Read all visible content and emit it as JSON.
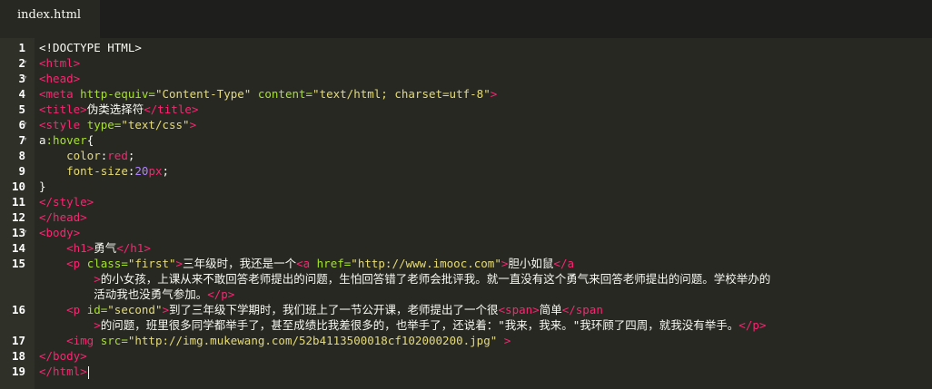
{
  "tab": {
    "filename": "index.html"
  },
  "lines": [
    {
      "n": "1",
      "rows": [
        [
          [
            "p",
            "<!DOCTYPE HTML>"
          ]
        ]
      ]
    },
    {
      "n": "2",
      "fold": true,
      "rows": [
        [
          [
            "t",
            "<html>"
          ]
        ]
      ]
    },
    {
      "n": "3",
      "fold": true,
      "rows": [
        [
          [
            "t",
            "<head>"
          ]
        ]
      ]
    },
    {
      "n": "4",
      "rows": [
        [
          [
            "t",
            "<meta "
          ],
          [
            "a",
            "http-equiv="
          ],
          [
            "s",
            "\"Content-Type\""
          ],
          [
            "a",
            " content="
          ],
          [
            "s",
            "\"text/html; charset=utf-8\""
          ],
          [
            "t",
            ">"
          ]
        ]
      ]
    },
    {
      "n": "5",
      "rows": [
        [
          [
            "t",
            "<title>"
          ],
          [
            "p",
            "伪类选择符"
          ],
          [
            "t",
            "</title>"
          ]
        ]
      ]
    },
    {
      "n": "6",
      "fold": true,
      "rows": [
        [
          [
            "t",
            "<style "
          ],
          [
            "a",
            "type="
          ],
          [
            "s",
            "\"text/css\""
          ],
          [
            "t",
            ">"
          ]
        ]
      ]
    },
    {
      "n": "7",
      "fold": true,
      "rows": [
        [
          [
            "p",
            "a"
          ],
          [
            "a",
            ":hover"
          ],
          [
            "p",
            "{"
          ]
        ]
      ]
    },
    {
      "n": "8",
      "rows": [
        [
          [
            "p",
            "    "
          ],
          [
            "k",
            "color"
          ],
          [
            "p",
            ":"
          ],
          [
            "v",
            "red"
          ],
          [
            "p",
            ";"
          ]
        ]
      ]
    },
    {
      "n": "9",
      "rows": [
        [
          [
            "p",
            "    "
          ],
          [
            "k",
            "font-size"
          ],
          [
            "p",
            ":"
          ],
          [
            "n",
            "20"
          ],
          [
            "v",
            "px"
          ],
          [
            "p",
            ";"
          ]
        ]
      ]
    },
    {
      "n": "10",
      "rows": [
        [
          [
            "p",
            "}"
          ]
        ]
      ]
    },
    {
      "n": "11",
      "rows": [
        [
          [
            "t",
            "</style>"
          ]
        ]
      ]
    },
    {
      "n": "12",
      "rows": [
        [
          [
            "t",
            "</head>"
          ]
        ]
      ]
    },
    {
      "n": "13",
      "fold": true,
      "rows": [
        [
          [
            "t",
            "<body>"
          ]
        ]
      ]
    },
    {
      "n": "14",
      "rows": [
        [
          [
            "p",
            "    "
          ],
          [
            "t",
            "<h1>"
          ],
          [
            "p",
            "勇气"
          ],
          [
            "t",
            "</h1>"
          ]
        ]
      ]
    },
    {
      "n": "15",
      "rows": [
        [
          [
            "p",
            "    "
          ],
          [
            "t",
            "<p "
          ],
          [
            "a",
            "class="
          ],
          [
            "s",
            "\"first\""
          ],
          [
            "t",
            ">"
          ],
          [
            "p",
            "三年级时，我还是一个"
          ],
          [
            "t",
            "<a "
          ],
          [
            "a",
            "href="
          ],
          [
            "s",
            "\"http://www.imooc.com\""
          ],
          [
            "t",
            ">"
          ],
          [
            "p",
            "胆小如鼠"
          ],
          [
            "t",
            "</a"
          ]
        ],
        [
          [
            "t",
            "        >"
          ],
          [
            "p",
            "的小女孩，上课从来不敢回答老师提出的问题，生怕回答错了老师会批评我。就一直没有这个勇气来回答老师提出的问题。学校举办的"
          ]
        ],
        [
          [
            "p",
            "        活动我也没勇气参加。"
          ],
          [
            "t",
            "</p>"
          ]
        ]
      ]
    },
    {
      "n": "16",
      "rows": [
        [
          [
            "p",
            "    "
          ],
          [
            "t",
            "<p "
          ],
          [
            "a",
            "id="
          ],
          [
            "s",
            "\"second\""
          ],
          [
            "t",
            ">"
          ],
          [
            "p",
            "到了三年级下学期时，我们班上了一节公开课，老师提出了一个很"
          ],
          [
            "t",
            "<span>"
          ],
          [
            "p",
            "简单"
          ],
          [
            "t",
            "</span"
          ]
        ],
        [
          [
            "t",
            "        >"
          ],
          [
            "p",
            "的问题，班里很多同学都举手了，甚至成绩比我差很多的，也举手了，还说着：\"我来，我来。\"我环顾了四周，就我没有举手。"
          ],
          [
            "t",
            "</p>"
          ]
        ]
      ]
    },
    {
      "n": "17",
      "rows": [
        [
          [
            "p",
            "    "
          ],
          [
            "t",
            "<img "
          ],
          [
            "a",
            "src="
          ],
          [
            "s",
            "\"http://img.mukewang.com/52b4113500018cf102000200.jpg\""
          ],
          [
            "p",
            " "
          ],
          [
            "t",
            ">"
          ]
        ]
      ]
    },
    {
      "n": "18",
      "rows": [
        [
          [
            "t",
            "</body>"
          ]
        ]
      ]
    },
    {
      "n": "19",
      "cursor": true,
      "rows": [
        [
          [
            "t",
            "</html>"
          ]
        ]
      ]
    }
  ]
}
